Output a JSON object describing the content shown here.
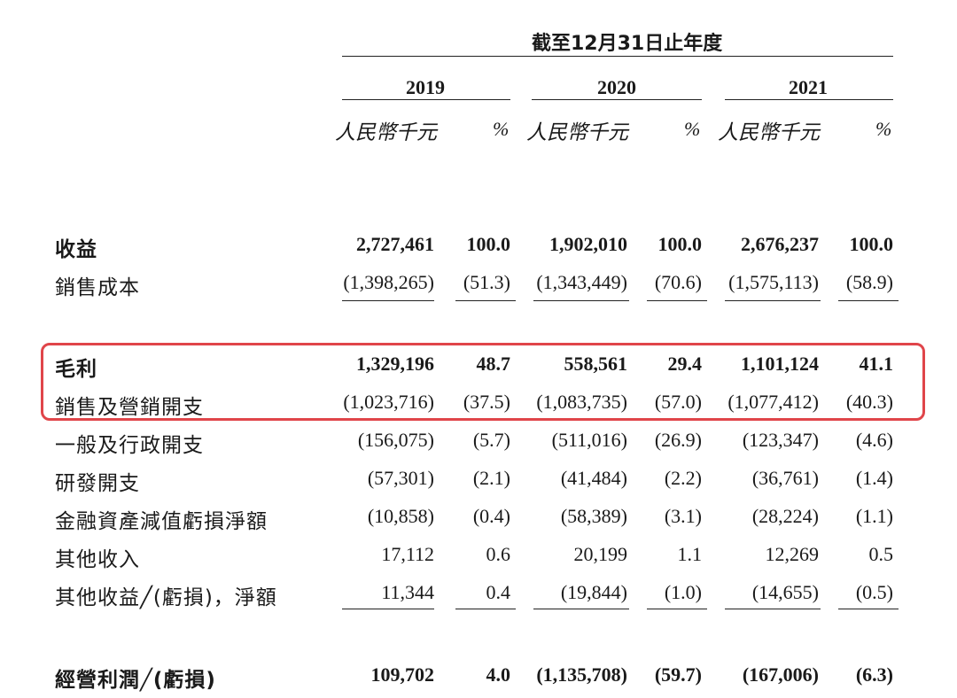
{
  "header": {
    "period_title": "截至12月31日止年度",
    "years": [
      "2019",
      "2020",
      "2021"
    ],
    "unit_caption": "人民幣千元",
    "pct_caption": "%"
  },
  "highlight_color": "#e0454a",
  "rows": [
    {
      "label": "收益",
      "bold": true,
      "values": [
        "2,727,461",
        "100.0",
        "1,902,010",
        "100.0",
        "2,676,237",
        "100.0"
      ]
    },
    {
      "label": "銷售成本",
      "bold": false,
      "values": [
        "(1,398,265)",
        "(51.3)",
        "(1,343,449)",
        "(70.6)",
        "(1,575,113)",
        "(58.9)"
      ]
    },
    {
      "label": "毛利",
      "bold": true,
      "values": [
        "1,329,196",
        "48.7",
        "558,561",
        "29.4",
        "1,101,124",
        "41.1"
      ]
    },
    {
      "label": "銷售及營銷開支",
      "bold": false,
      "values": [
        "(1,023,716)",
        "(37.5)",
        "(1,083,735)",
        "(57.0)",
        "(1,077,412)",
        "(40.3)"
      ]
    },
    {
      "label": "一般及行政開支",
      "bold": false,
      "values": [
        "(156,075)",
        "(5.7)",
        "(511,016)",
        "(26.9)",
        "(123,347)",
        "(4.6)"
      ]
    },
    {
      "label": "研發開支",
      "bold": false,
      "values": [
        "(57,301)",
        "(2.1)",
        "(41,484)",
        "(2.2)",
        "(36,761)",
        "(1.4)"
      ]
    },
    {
      "label": "金融資產減值虧損淨額",
      "bold": false,
      "values": [
        "(10,858)",
        "(0.4)",
        "(58,389)",
        "(3.1)",
        "(28,224)",
        "(1.1)"
      ]
    },
    {
      "label": "其他收入",
      "bold": false,
      "values": [
        "17,112",
        "0.6",
        "20,199",
        "1.1",
        "12,269",
        "0.5"
      ]
    },
    {
      "label": "其他收益╱(虧損)，淨額",
      "bold": false,
      "values": [
        "11,344",
        "0.4",
        "(19,844)",
        "(1.0)",
        "(14,655)",
        "(0.5)"
      ]
    },
    {
      "label": "經營利潤╱(虧損)",
      "bold": true,
      "values": [
        "109,702",
        "4.0",
        "(1,135,708)",
        "(59.7)",
        "(167,006)",
        "(6.3)"
      ]
    }
  ]
}
